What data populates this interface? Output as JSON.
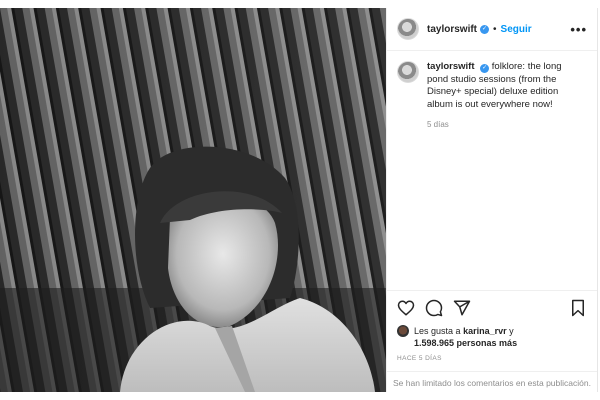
{
  "post": {
    "username": "taylorswift",
    "follow_label": "Seguir",
    "more_label": "•••",
    "caption": "folklore: the long pond studio sessions (from the Disney+ special) deluxe edition album is out everywhere now!",
    "caption_time": "5 días",
    "likes_prefix": "Les gusta a",
    "likes_user": "karina_rvr",
    "likes_middle": "y",
    "likes_count": "1.598.965 personas más",
    "posted_ago": "HACE 5 DÍAS",
    "comments_notice": "Se han limitado los comentarios en esta publicación."
  },
  "icons": {
    "verified": "verified-badge-icon",
    "like": "heart-icon",
    "comment": "comment-icon",
    "share": "paper-plane-icon",
    "save": "bookmark-icon"
  },
  "colors": {
    "accent": "#0095f6",
    "verified": "#3897f0",
    "muted": "#8e8e8e"
  }
}
